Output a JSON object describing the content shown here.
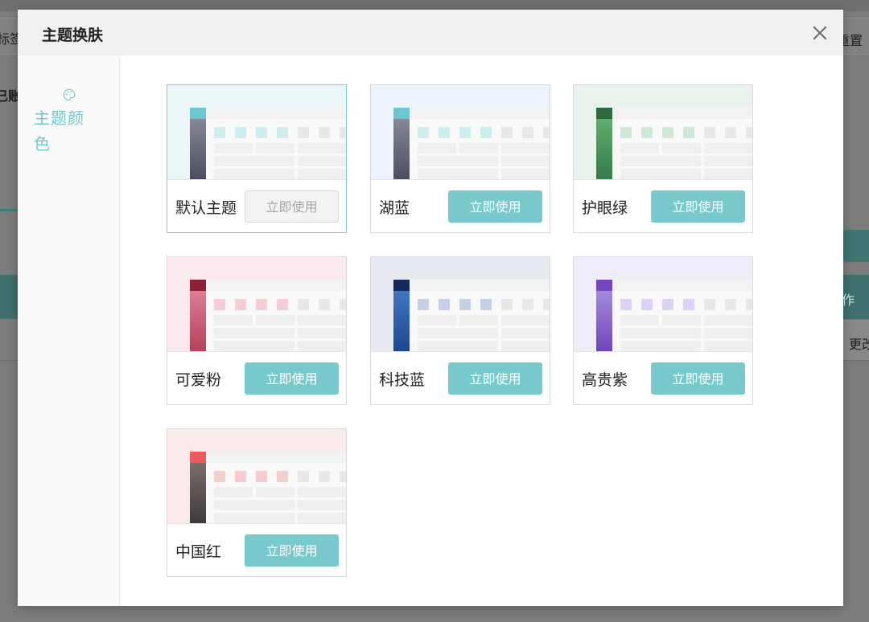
{
  "background": {
    "tag_label": "标签",
    "reset_label": "重置",
    "account_label": "已账",
    "op_label": "作",
    "edit_label": "更改"
  },
  "modal": {
    "title": "主题换肤",
    "close_icon": "close-icon"
  },
  "sidebar": {
    "icon": "palette-icon",
    "label": "主题颜色",
    "active_color": "#6ec8ca"
  },
  "themes": [
    {
      "name": "默认主题",
      "button": "立即使用",
      "active": true,
      "band": "#eaf6f7",
      "top": "#6cc5cf",
      "side_a": "#878895",
      "side_b": "#4b4c5d",
      "square": "#cdeef0"
    },
    {
      "name": "湖蓝",
      "button": "立即使用",
      "active": false,
      "band": "#eef4fd",
      "top": "#6cc5cf",
      "side_a": "#878895",
      "side_b": "#4b4c5d",
      "square": "#cdeef0"
    },
    {
      "name": "护眼绿",
      "button": "立即使用",
      "active": false,
      "band": "#e9f3ec",
      "top": "#2f6a3f",
      "side_a": "#5fae71",
      "side_b": "#357a48",
      "square": "#cfe8d6"
    },
    {
      "name": "可爱粉",
      "button": "立即使用",
      "active": false,
      "band": "#f9e8ec",
      "top": "#8f1f36",
      "side_a": "#dc7d93",
      "side_b": "#b63f5c",
      "square": "#f6cdd7"
    },
    {
      "name": "科技蓝",
      "button": "立即使用",
      "active": false,
      "band": "#e6e9f0",
      "top": "#14295a",
      "side_a": "#3f78c0",
      "side_b": "#1d4590",
      "square": "#c4d0e8"
    },
    {
      "name": "高贵紫",
      "button": "立即使用",
      "active": false,
      "band": "#f0ecfa",
      "top": "#7446c4",
      "side_a": "#a78add",
      "side_b": "#6b45b8",
      "square": "#ddd2f6"
    },
    {
      "name": "中国红",
      "button": "立即使用",
      "active": false,
      "band": "#f9e9e9",
      "top": "#ef5b5b",
      "side_a": "#7a6c6c",
      "side_b": "#3e3a3a",
      "square": "#f6cdcd"
    }
  ]
}
